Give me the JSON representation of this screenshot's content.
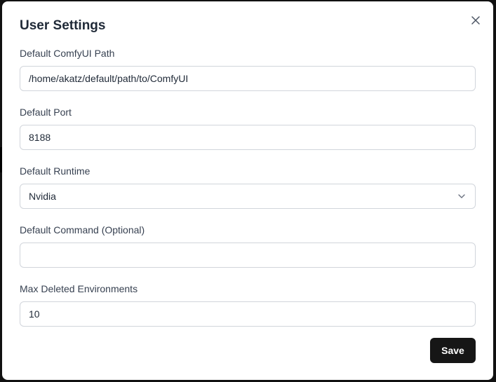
{
  "dialog": {
    "title": "User Settings",
    "close_icon": "close-icon",
    "save_label": "Save"
  },
  "fields": {
    "comfyui_path": {
      "label": "Default ComfyUI Path",
      "value": "/home/akatz/default/path/to/ComfyUI"
    },
    "port": {
      "label": "Default Port",
      "value": "8188"
    },
    "runtime": {
      "label": "Default Runtime",
      "value": "Nvidia",
      "icon": "chevron-down-icon"
    },
    "command": {
      "label": "Default Command (Optional)",
      "value": ""
    },
    "max_deleted": {
      "label": "Max Deleted Environments",
      "value": "10"
    }
  },
  "colors": {
    "primary_button": "#161616",
    "border": "#d1d5db",
    "text": "#1f2937"
  }
}
